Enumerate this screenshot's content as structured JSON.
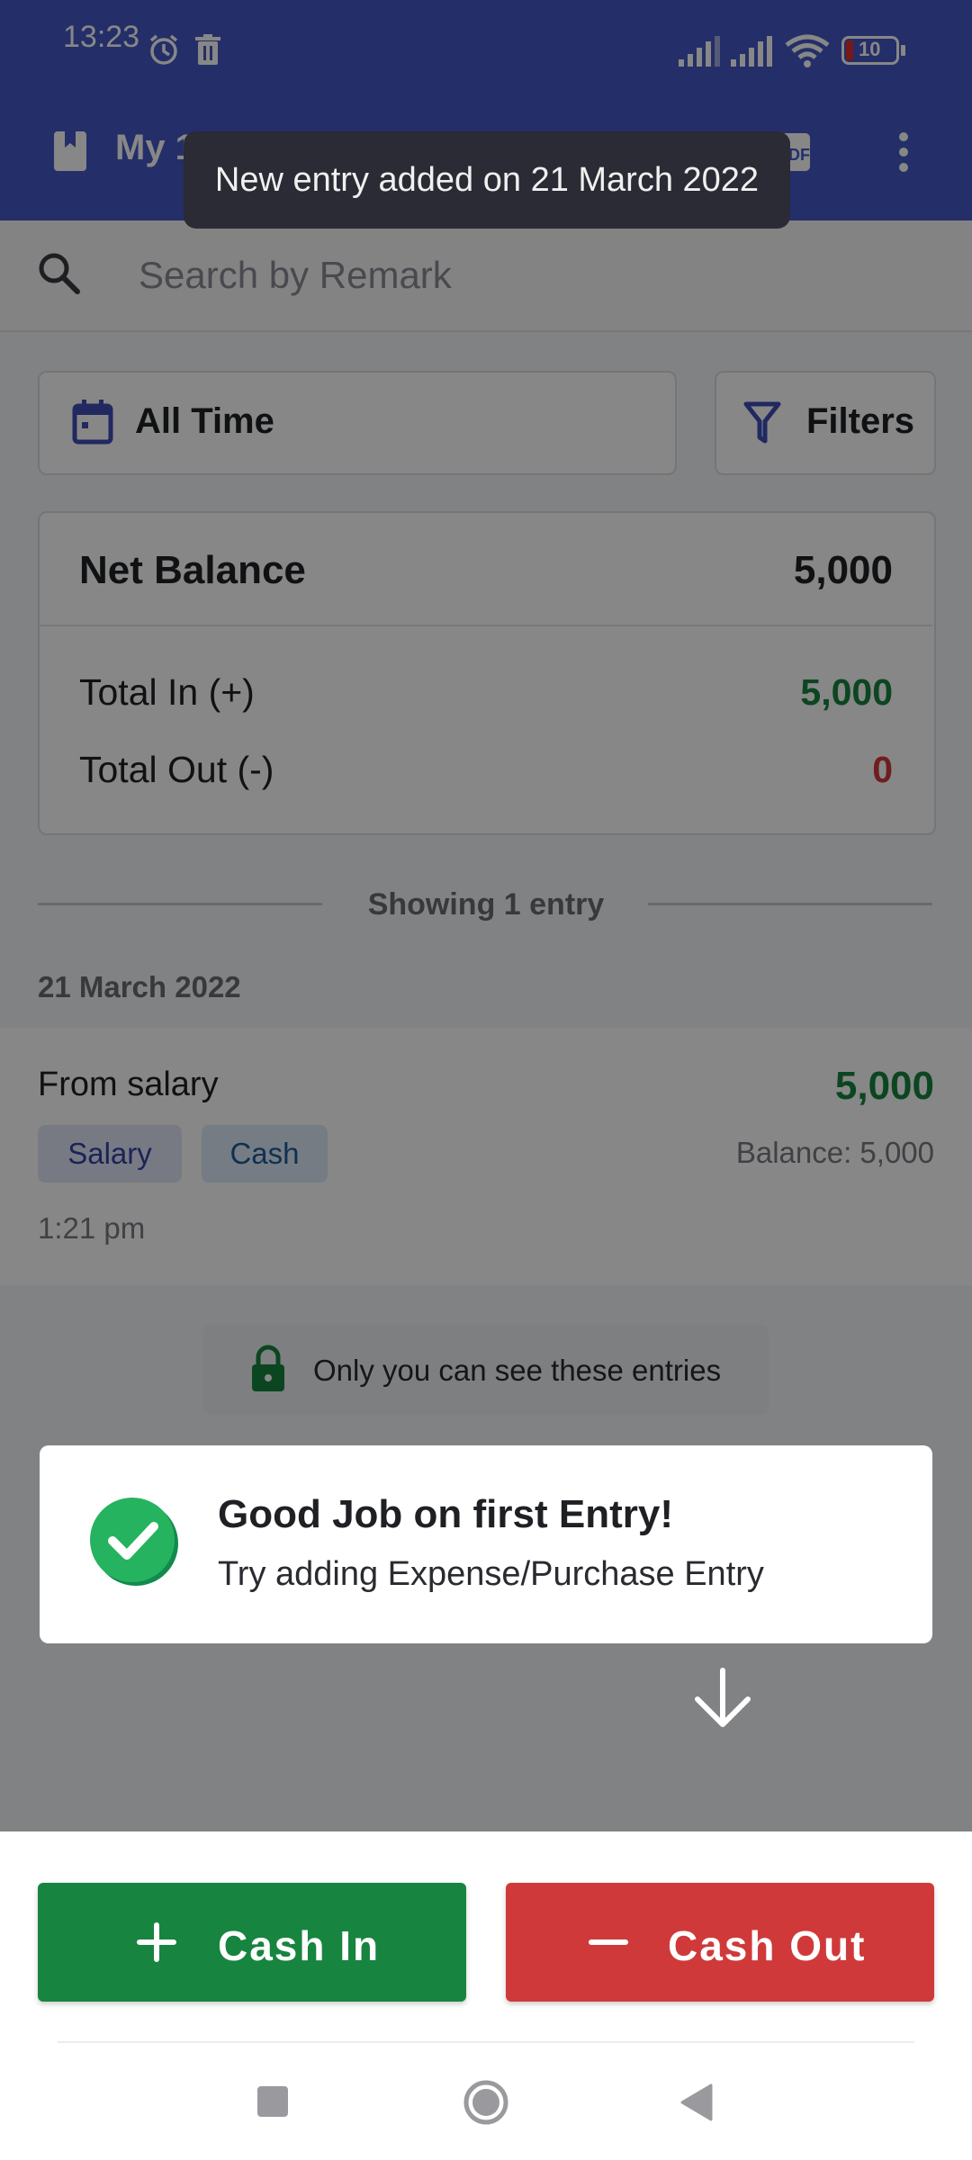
{
  "status_bar": {
    "time": "13:23",
    "battery": "10",
    "icons": [
      "alarm-icon",
      "trash-icon",
      "signal-icon",
      "signal-icon",
      "wifi-icon",
      "battery-icon"
    ]
  },
  "app_bar": {
    "title": "My 1",
    "menu_icon": "more-vert-icon",
    "book_icon": "book-icon",
    "pdf_icon": "pdf-icon"
  },
  "toast": {
    "text": "New entry added on 21 March 2022"
  },
  "search": {
    "placeholder": "Search by Remark"
  },
  "filters": {
    "date_label": "All Time",
    "filter_label": "Filters"
  },
  "summary": {
    "net_balance_label": "Net Balance",
    "net_balance_value": "5,000",
    "total_in_label": "Total In (+)",
    "total_in_value": "5,000",
    "total_out_label": "Total Out (-)",
    "total_out_value": "0"
  },
  "entries_header": {
    "showing": "Showing 1 entry",
    "date": "21 March 2022"
  },
  "entry": {
    "remark": "From salary",
    "amount": "5,000",
    "tags": [
      "Salary",
      "Cash"
    ],
    "balance": "Balance: 5,000",
    "time": "1:21 pm"
  },
  "privacy": {
    "text": "Only you can see these entries"
  },
  "tip": {
    "title": "Good Job on first Entry!",
    "subtitle": "Try adding Expense/Purchase Entry"
  },
  "actions": {
    "cash_in": "Cash In",
    "cash_out": "Cash Out"
  },
  "colors": {
    "primary": "#4457c5",
    "green": "#17843f",
    "red": "#d0393a"
  }
}
